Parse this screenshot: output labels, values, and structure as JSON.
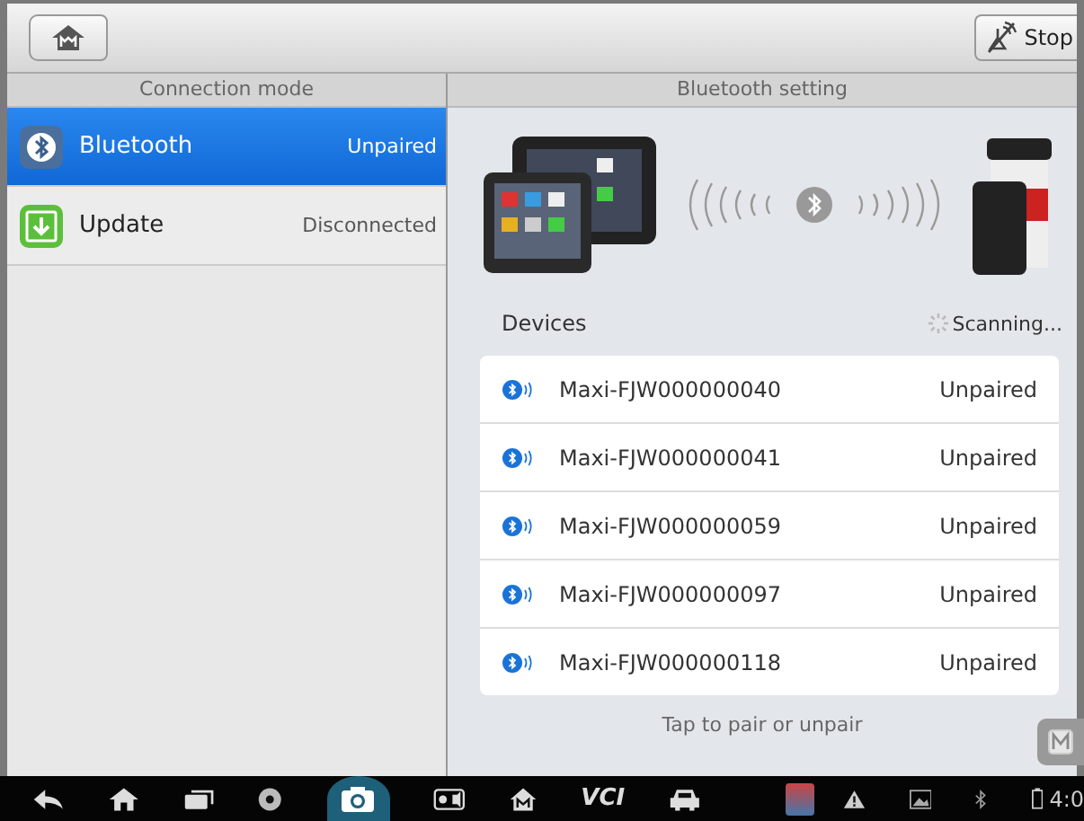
{
  "toolbar": {
    "stop_label": "Stop"
  },
  "left_panel": {
    "header": "Connection mode",
    "items": [
      {
        "kind": "bluetooth",
        "label": "Bluetooth",
        "status": "Unpaired",
        "selected": true
      },
      {
        "kind": "update",
        "label": "Update",
        "status": "Disconnected",
        "selected": false
      }
    ]
  },
  "right_panel": {
    "header": "Bluetooth setting",
    "devices_label": "Devices",
    "scanning_label": "Scanning...",
    "devices": [
      {
        "name": "Maxi-FJW000000040",
        "status": "Unpaired"
      },
      {
        "name": "Maxi-FJW000000041",
        "status": "Unpaired"
      },
      {
        "name": "Maxi-FJW000000059",
        "status": "Unpaired"
      },
      {
        "name": "Maxi-FJW000000097",
        "status": "Unpaired"
      },
      {
        "name": "Maxi-FJW000000118",
        "status": "Unpaired"
      }
    ],
    "hint": "Tap to pair or unpair"
  },
  "nav_bar": {
    "vci_label": "VCI",
    "time": "4:0"
  }
}
